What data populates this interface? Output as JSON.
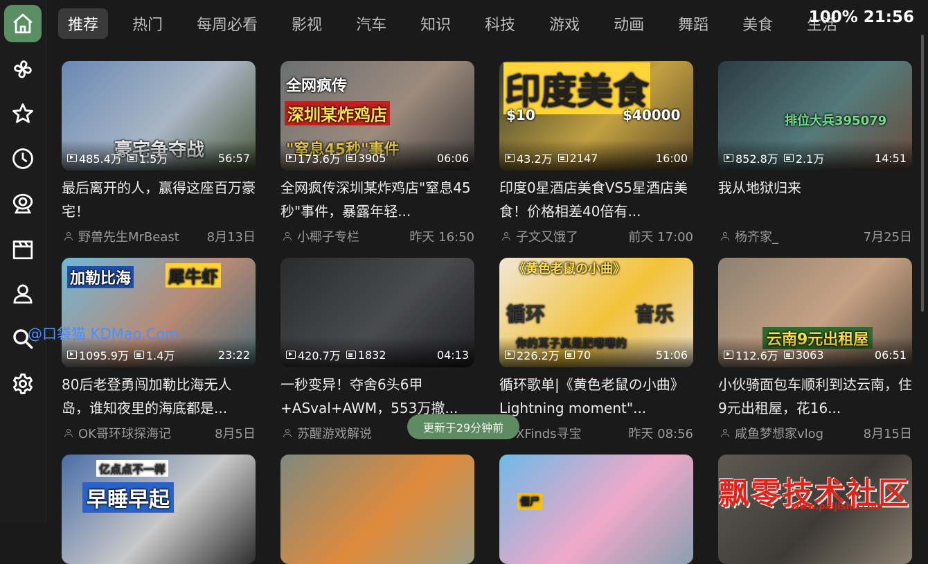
{
  "status": {
    "text": "100% 21:56"
  },
  "tabs": [
    "推荐",
    "热门",
    "每周必看",
    "影视",
    "汽车",
    "知识",
    "科技",
    "游戏",
    "动画",
    "舞蹈",
    "美食",
    "生活"
  ],
  "active_tab": 0,
  "sidebar": [
    {
      "icon": "home-icon",
      "active": true
    },
    {
      "icon": "pinwheel-icon"
    },
    {
      "icon": "star-icon"
    },
    {
      "icon": "clock-icon"
    },
    {
      "icon": "webcam-icon"
    },
    {
      "icon": "clapperboard-icon"
    },
    {
      "icon": "user-icon"
    },
    {
      "icon": "search-icon"
    },
    {
      "icon": "gear-icon"
    }
  ],
  "videos": [
    {
      "views": "485.4万",
      "danmaku": "1.5万",
      "duration": "56:57",
      "title": "最后离开的人，赢得这座百万豪宅！",
      "uploader": "野兽先生MrBeast",
      "date": "8月13日",
      "thumb_text": "豪宅争夺战",
      "bg": [
        "#6a89b5",
        "#a9b6c4",
        "#4b5a3a"
      ]
    },
    {
      "views": "173.6万",
      "danmaku": "3905",
      "duration": "06:06",
      "title": "全网疯传深圳某炸鸡店\"窒息45秒\"事件，暴露年轻...",
      "uploader": "小椰子专栏",
      "date": "昨天 16:50",
      "thumb_text": "全网疯传",
      "thumb_text2": "深圳某炸鸡店",
      "thumb_text3": "\"窒息45秒\"事件",
      "bg": [
        "#6b6f72",
        "#9c8b7c",
        "#3c3a3a"
      ]
    },
    {
      "views": "43.2万",
      "danmaku": "2147",
      "duration": "16:00",
      "title": "印度0星酒店美食VS5星酒店美食！价格相差40倍有...",
      "uploader": "子文又饿了",
      "date": "前天 17:00",
      "thumb_text": "印度美食",
      "thumb_text2": "$10",
      "thumb_text3": "$40000",
      "bg": [
        "#38402e",
        "#c2a041",
        "#5c4a2a"
      ]
    },
    {
      "views": "852.8万",
      "danmaku": "2.1万",
      "duration": "14:51",
      "title": "我从地狱归来",
      "uploader": "杨齐家_",
      "date": "7月25日",
      "thumb_text": "排位大兵395079",
      "bg": [
        "#2c3b44",
        "#557a7a",
        "#6a4a3a"
      ]
    },
    {
      "views": "1095.9万",
      "danmaku": "1.4万",
      "duration": "23:22",
      "title": "80后老登勇闯加勒比海无人岛，谁知夜里的海底都是...",
      "uploader": "OK哥环球探海记",
      "date": "8月5日",
      "thumb_text": "加勒比海",
      "thumb_text2": "犀牛虾",
      "bg": [
        "#6fb8d8",
        "#b98a74",
        "#4c6b77"
      ]
    },
    {
      "views": "420.7万",
      "danmaku": "1832",
      "duration": "04:13",
      "title": "一秒变异！夺舍6头6甲+ASval+AWM，553万撤...",
      "uploader": "苏醒游戏解说",
      "date": "",
      "bg": [
        "#2a2b2d",
        "#4a4b4d",
        "#1f2022"
      ]
    },
    {
      "views": "226.2万",
      "danmaku": "70",
      "duration": "51:06",
      "title": "循环歌单|《黄色老鼠の小曲》Lightning moment\"...",
      "uploader": "XFinds寻宝",
      "date": "昨天 08:56",
      "thumb_text": "《黄色老鼠の小曲》",
      "thumb_text2": "循环",
      "thumb_text3": "音乐",
      "thumb_text4": "你的耳子真是肥嘟嘟的",
      "bg": [
        "#f1e7d6",
        "#f3c23a",
        "#e9dcc7"
      ]
    },
    {
      "views": "112.6万",
      "danmaku": "3063",
      "duration": "06:51",
      "title": "小伙骑面包车顺利到达云南，住9元出租屋，花16...",
      "uploader": "咸鱼梦想家vlog",
      "date": "8月15日",
      "thumb_text": "云南9元出租屋",
      "bg": [
        "#8c8171",
        "#c7a284",
        "#5b4f43"
      ]
    },
    {
      "views": "",
      "danmaku": "",
      "duration": "",
      "title": "",
      "uploader": "",
      "date": "",
      "thumb_text": "早睡早起",
      "thumb_text2": "亿点点不一样",
      "bg": [
        "#4a6ea8",
        "#c9c9c9",
        "#2e2e2e"
      ]
    },
    {
      "views": "",
      "danmaku": "",
      "duration": "",
      "title": "",
      "uploader": "",
      "date": "",
      "bg": [
        "#7e8a7c",
        "#e08a3c",
        "#9c9e84"
      ]
    },
    {
      "views": "",
      "danmaku": "",
      "duration": "",
      "title": "",
      "uploader": "",
      "date": "",
      "thumb_text": "僵尸",
      "bg": [
        "#6fb9e6",
        "#f0a8c8",
        "#8aa0b0"
      ]
    },
    {
      "views": "",
      "danmaku": "",
      "duration": "",
      "title": "",
      "uploader": "",
      "date": "",
      "bg": [
        "#5e5a52",
        "#3e3a36",
        "#8a8070"
      ]
    }
  ],
  "toast": "更新于29分钟前",
  "watermark_left": "@口袋猫 KDMao.Com",
  "watermark_right": "飘零技术社区",
  "watermark_right_url": "www.paijishu.com"
}
